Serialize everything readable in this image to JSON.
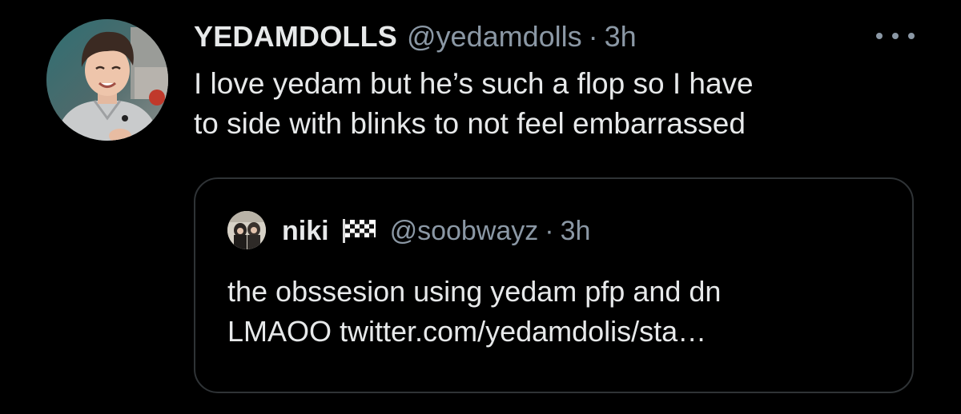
{
  "tweet": {
    "display_name": "YEDAMDOLLS",
    "handle": "@yedamdolls",
    "separator": "·",
    "time": "3h",
    "text_line1": "I love yedam but he’s such a flop so I have",
    "text_line2": "to side with blinks to not feel embarrassed",
    "more_icon": "more-horizontal-icon"
  },
  "quote": {
    "display_name": "niki",
    "name_emoji": "checkered-flag-icon",
    "handle": "@soobwayz",
    "separator": "·",
    "time": "3h",
    "text_line1": "the obssesion using yedam pfp and dn",
    "text_line2": "LMAOO twitter.com/yedamdolis/sta…"
  },
  "colors": {
    "background": "#000000",
    "primary_text": "#e7e9ea",
    "secondary_text": "#8b98a5",
    "border": "#2f3336"
  }
}
